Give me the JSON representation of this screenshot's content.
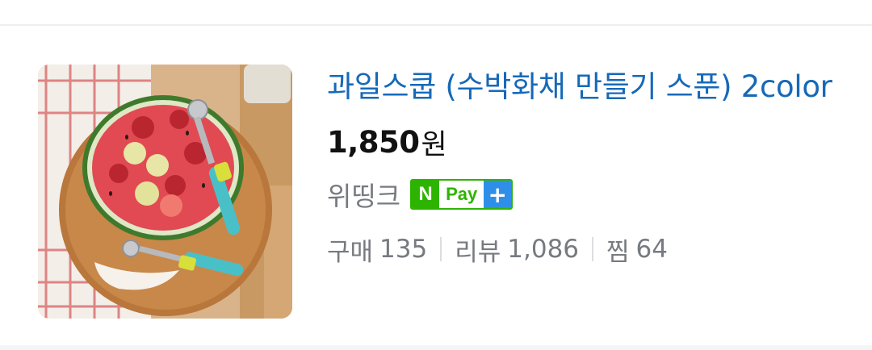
{
  "product": {
    "image_alt": "watermelon scoop product photo",
    "title": "과일스쿱 (수박화채 만들기 스푼) 2color",
    "price": "1,850",
    "price_unit": "원",
    "seller": "위띵크",
    "npay_badge": {
      "n": "N",
      "pay": "Pay",
      "plus": "+"
    },
    "stats": {
      "purchase_label": "구매",
      "purchase_value": "135",
      "review_label": "리뷰",
      "review_value": "1,086",
      "wish_label": "찜",
      "wish_value": "64"
    }
  },
  "colors": {
    "title": "#1669b8",
    "meta": "#777a80",
    "npay_green": "#2db400",
    "npay_blue": "#2f8fe8"
  }
}
